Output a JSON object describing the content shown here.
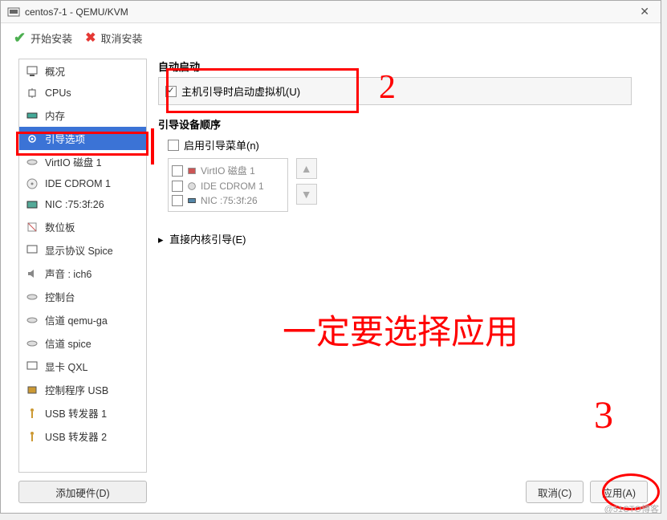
{
  "window": {
    "title": "centos7-1 - QEMU/KVM"
  },
  "toolbar": {
    "start_install": "开始安装",
    "cancel_install": "取消安装"
  },
  "sidebar": {
    "items": [
      {
        "label": "概况"
      },
      {
        "label": "CPUs"
      },
      {
        "label": "内存"
      },
      {
        "label": "引导选项"
      },
      {
        "label": "VirtIO 磁盘 1"
      },
      {
        "label": "IDE CDROM 1"
      },
      {
        "label": "NIC :75:3f:26"
      },
      {
        "label": "数位板"
      },
      {
        "label": "显示协议 Spice"
      },
      {
        "label": "声音 : ich6"
      },
      {
        "label": "控制台"
      },
      {
        "label": "信道 qemu-ga"
      },
      {
        "label": "信道 spice"
      },
      {
        "label": "显卡 QXL"
      },
      {
        "label": "控制程序 USB"
      },
      {
        "label": "USB 转发器 1"
      },
      {
        "label": "USB 转发器 2"
      }
    ],
    "add_hardware": "添加硬件(D)"
  },
  "main": {
    "autostart_title": "自动启动",
    "autostart_checkbox": "主机引导时启动虚拟机(U)",
    "boot_order_title": "引导设备顺序",
    "enable_boot_menu": "启用引导菜单(n)",
    "boot_items": [
      {
        "label": "VirtIO 磁盘 1"
      },
      {
        "label": "IDE CDROM 1"
      },
      {
        "label": "NIC :75:3f:26"
      }
    ],
    "direct_kernel_boot": "直接内核引导(E)"
  },
  "footer": {
    "cancel": "取消(C)",
    "apply": "应用(A)"
  },
  "annotations": {
    "num2": "2",
    "big_text": "一定要选择应用",
    "num3": "3"
  },
  "watermark": "@51CTO博客"
}
